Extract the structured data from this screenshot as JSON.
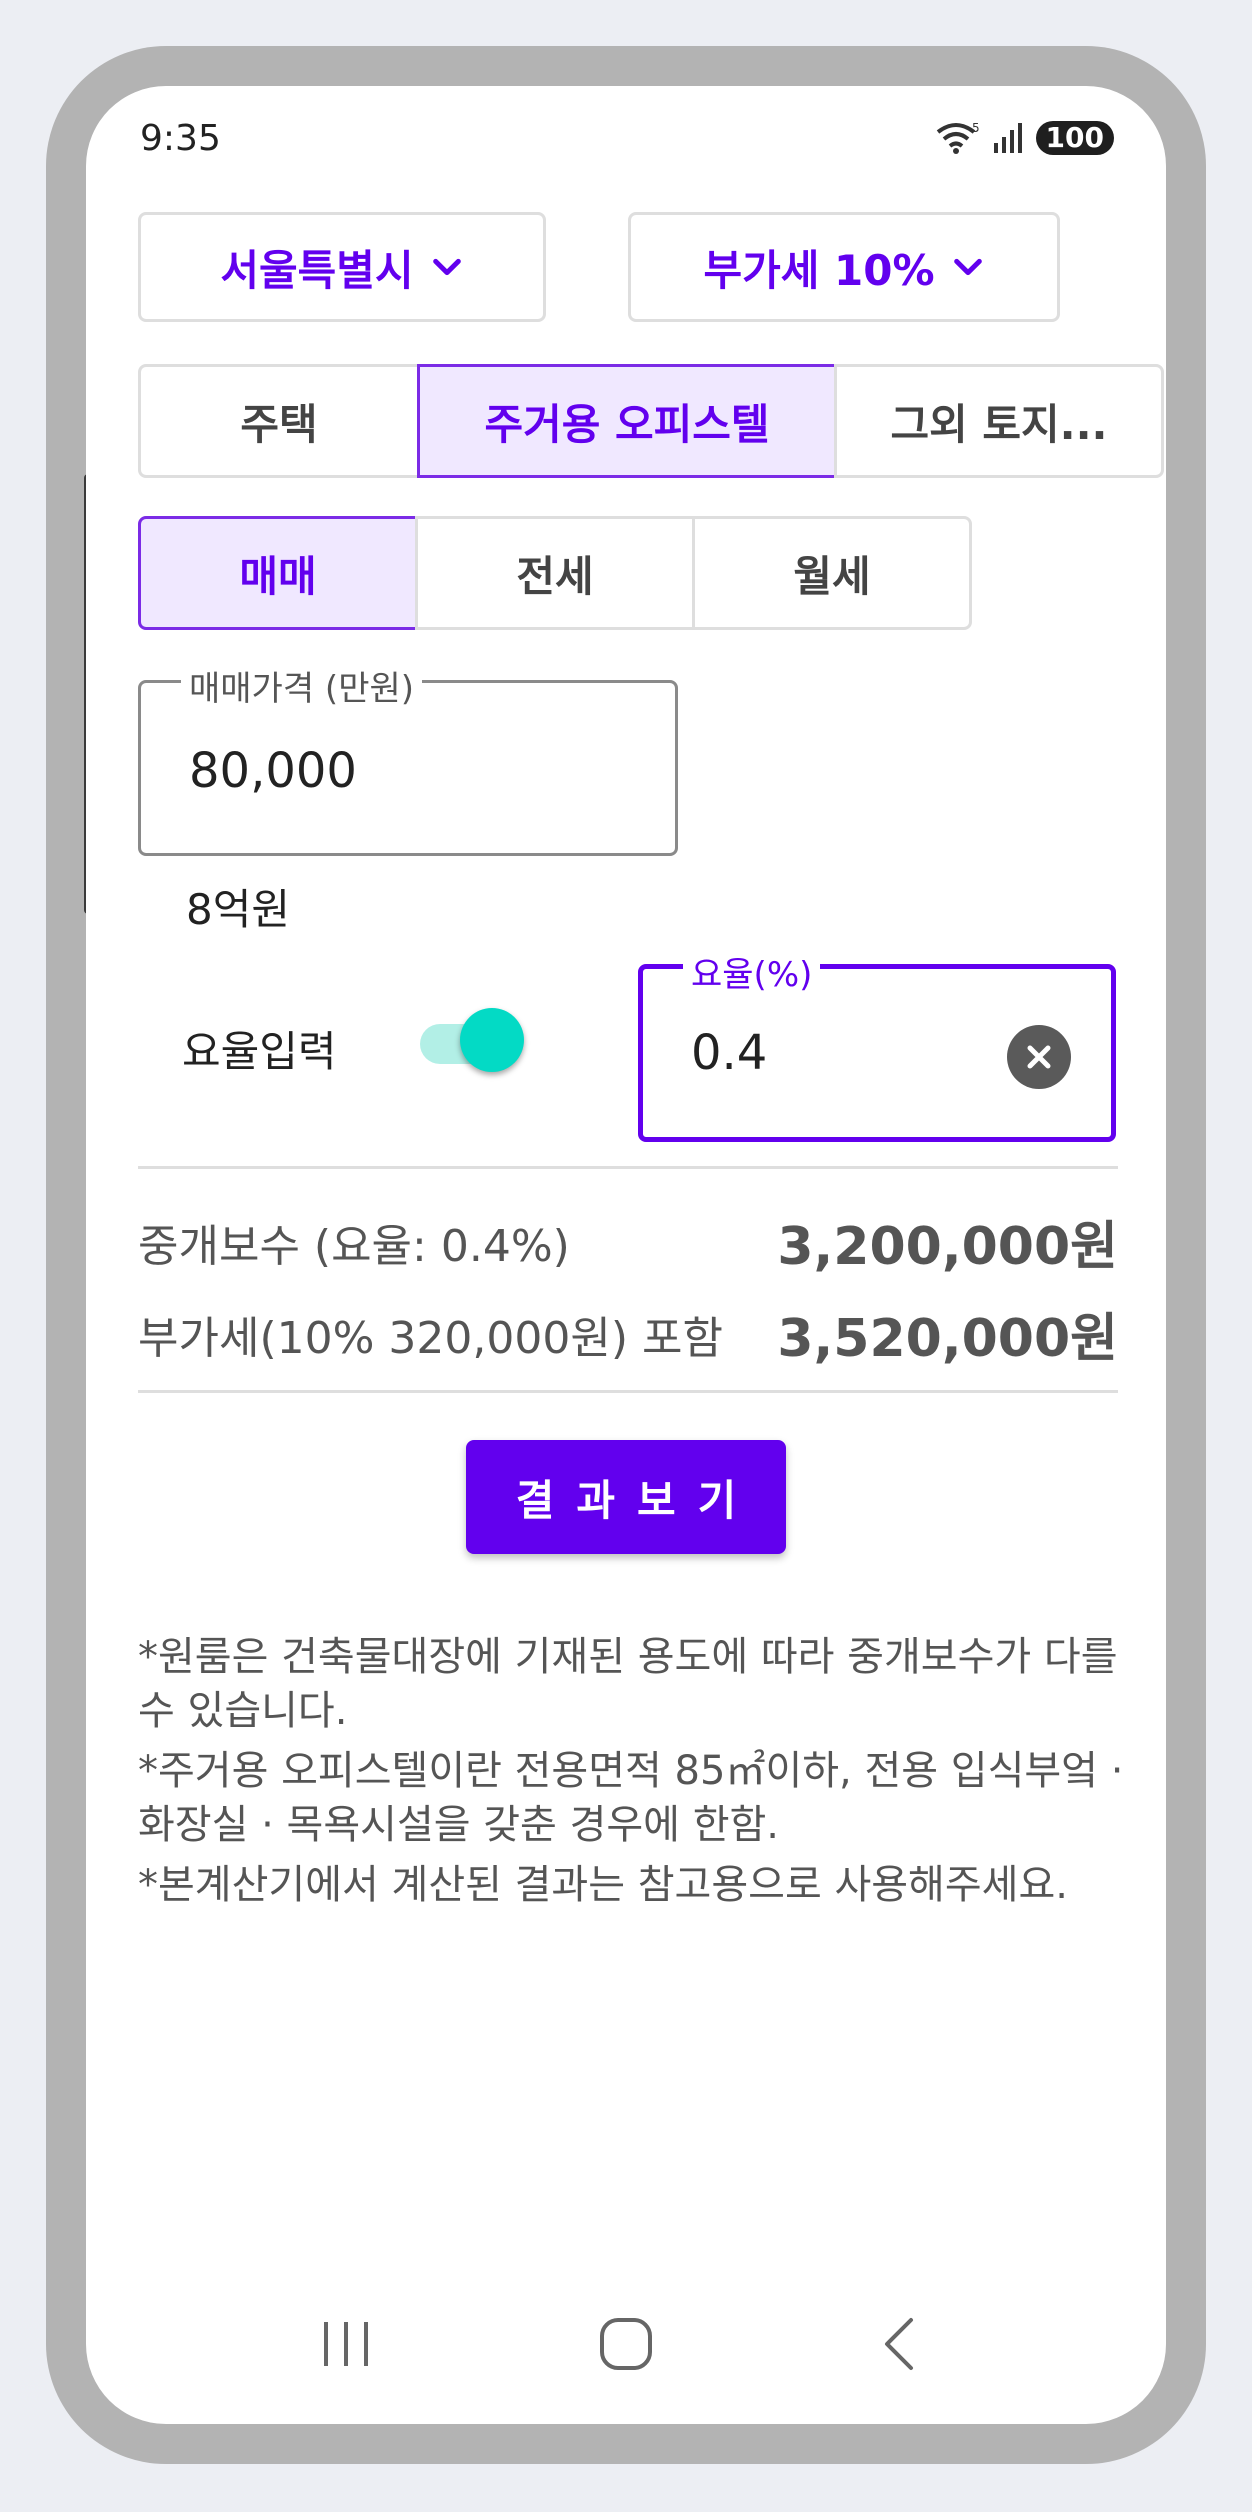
{
  "status_bar": {
    "time": "9:35",
    "battery": "100",
    "wifi_badge": "5"
  },
  "selectors": {
    "region": "서울특별시",
    "vat": "부가세 10%"
  },
  "property_tabs": [
    "주택",
    "주거용 오피스텔",
    "그외 토지..."
  ],
  "property_active": 1,
  "deal_tabs": [
    "매매",
    "전세",
    "월세"
  ],
  "deal_active": 0,
  "price_field": {
    "label": "매매가격 (만원)",
    "value": "80,000",
    "helper": "8억원"
  },
  "rate_toggle": {
    "label": "요율입력",
    "on": true
  },
  "rate_field": {
    "label": "요율(%)",
    "value": "0.4"
  },
  "results": [
    {
      "label": "중개보수 (요율: 0.4%)",
      "value": "3,200,000원"
    },
    {
      "label": "부가세(10% 320,000원) 포함",
      "value": "3,520,000원"
    }
  ],
  "result_button": "결과보기",
  "notes": [
    "*원룸은 건축물대장에 기재된 용도에 따라 중개보수가 다를 수 있습니다.",
    "*주거용 오피스텔이란 전용면적 85㎡이하, 전용 입식부엌 · 화장실 · 목욕시설을 갖춘 경우에 한함.",
    "*본계산기에서 계산된 결과는 참고용으로 사용해주세요."
  ],
  "colors": {
    "accent": "#6200ee",
    "toggle": "#03dac5",
    "text_muted": "#555555"
  },
  "icons": [
    "wifi-icon",
    "signal-icon",
    "chevron-down-icon",
    "clear-icon",
    "recents-icon",
    "home-icon",
    "back-icon"
  ]
}
